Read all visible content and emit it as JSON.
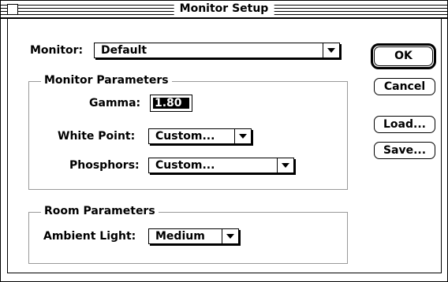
{
  "window": {
    "title": "Monitor Setup"
  },
  "monitor": {
    "label": "Monitor:",
    "value": "Default"
  },
  "monitor_parameters": {
    "title": "Monitor Parameters",
    "gamma_label": "Gamma:",
    "gamma_value": "1.80",
    "white_point_label": "White Point:",
    "white_point_value": "Custom...",
    "phosphors_label": "Phosphors:",
    "phosphors_value": "Custom..."
  },
  "room_parameters": {
    "title": "Room Parameters",
    "ambient_light_label": "Ambient Light:",
    "ambient_light_value": "Medium"
  },
  "buttons": {
    "ok": "OK",
    "cancel": "Cancel",
    "load": "Load...",
    "save": "Save..."
  }
}
